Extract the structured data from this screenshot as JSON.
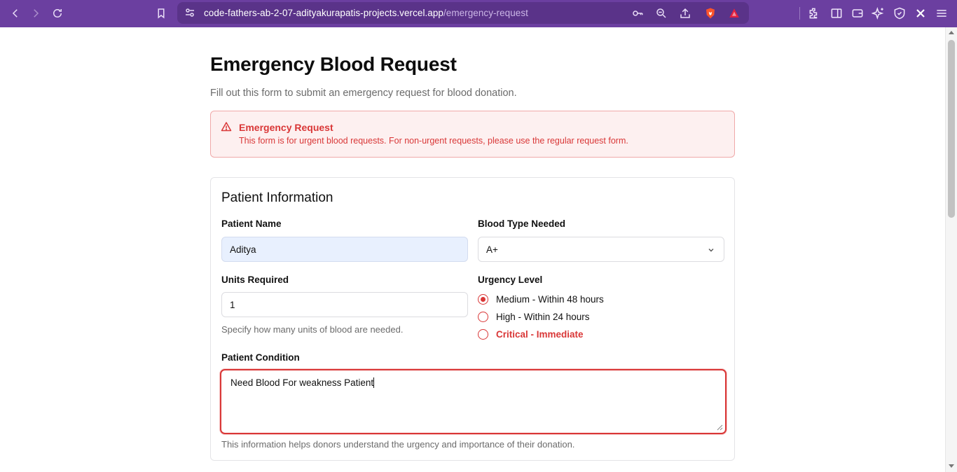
{
  "browser": {
    "url_host": "code-fathers-ab-2-07-adityakurapatis-projects.vercel.app",
    "url_path": "/emergency-request",
    "theme_color": "#6b3fa0"
  },
  "page": {
    "title": "Emergency Blood Request",
    "subtitle": "Fill out this form to submit an emergency request for blood donation."
  },
  "alert": {
    "title": "Emergency Request",
    "message": "This form is for urgent blood requests. For non-urgent requests, please use the regular request form.",
    "icon": "warning-triangle-icon",
    "color": "#d93737"
  },
  "patient_info": {
    "heading": "Patient Information",
    "patient_name": {
      "label": "Patient Name",
      "value": "Aditya"
    },
    "blood_type": {
      "label": "Blood Type Needed",
      "value": "A+"
    },
    "units": {
      "label": "Units Required",
      "value": "1",
      "hint": "Specify how many units of blood are needed."
    },
    "urgency": {
      "label": "Urgency Level",
      "options": [
        {
          "label": "Medium - Within 48 hours",
          "checked": true
        },
        {
          "label": "High - Within 24 hours",
          "checked": false
        },
        {
          "label": "Critical - Immediate",
          "checked": false
        }
      ]
    },
    "condition": {
      "label": "Patient Condition",
      "value": "Need Blood For weakness Patient",
      "hint": "This information helps donors understand the urgency and importance of their donation."
    }
  }
}
